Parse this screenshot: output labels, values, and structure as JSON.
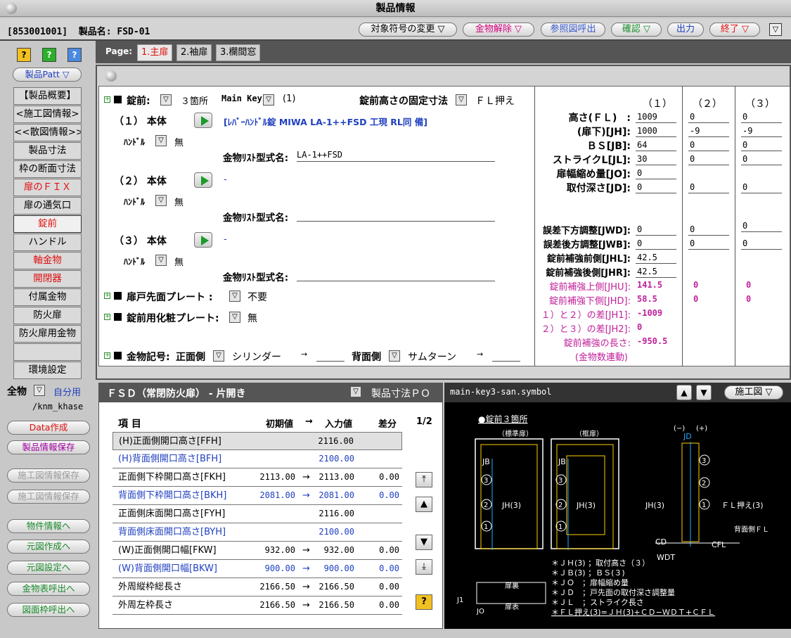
{
  "window": {
    "title": "製品情報"
  },
  "header": {
    "code": "[853001001]",
    "product_label": "製品名: FSD-01",
    "buttons": [
      {
        "label": "対象符号の変更 ▽",
        "color": "#000"
      },
      {
        "label": "金物解除 ▽",
        "color": "#d0007a"
      },
      {
        "label": "参照図呼出",
        "color": "#3a58c8"
      },
      {
        "label": "確認 ▽",
        "color": "#1a8a2a"
      },
      {
        "label": "出力",
        "color": "#2040c0"
      },
      {
        "label": "終了 ▽",
        "color": "#e01010"
      }
    ],
    "corner": "▽"
  },
  "sidebar": {
    "help": [
      "?",
      "?",
      "?"
    ],
    "pattern": "製品Patt ▽",
    "items": [
      {
        "label": "【製品概要】",
        "color": "#000"
      },
      {
        "label": "<施工図情報>",
        "color": "#000"
      },
      {
        "label": "<<散図情報>>",
        "color": "#000"
      },
      {
        "label": "製品寸法",
        "color": "#000"
      },
      {
        "label": "枠の断面寸法",
        "color": "#000"
      },
      {
        "label": "扉のＦＩＸ",
        "color": "#e01010"
      },
      {
        "label": "扉の通気口",
        "color": "#000"
      },
      {
        "label": "錠前",
        "color": "#e01010"
      },
      {
        "label": "ハンドル",
        "color": "#000"
      },
      {
        "label": "軸金物",
        "color": "#e01010"
      },
      {
        "label": "開閉器",
        "color": "#e01010"
      },
      {
        "label": "付属金物",
        "color": "#000"
      },
      {
        "label": "防火扉",
        "color": "#000"
      },
      {
        "label": "防火扉用金物",
        "color": "#000"
      },
      {
        "label": "",
        "color": "#000"
      },
      {
        "label": "環境設定",
        "color": "#000"
      }
    ],
    "kanamono_label": "全物",
    "kanamono_mode": "自分用",
    "path": "/knm_khase",
    "actions": [
      {
        "label": "Data作成",
        "color": "#e01010"
      },
      {
        "label": "製品情報保存",
        "color": "#a000a0"
      },
      {
        "label": "施工図情報保存",
        "color": "#9a9a9a"
      },
      {
        "label": "施工図情報保存",
        "color": "#9a9a9a"
      },
      {
        "label": "物件情報へ",
        "color": "#1a8a2a"
      },
      {
        "label": "元図作成へ",
        "color": "#1a8a2a"
      },
      {
        "label": "元図設定へ",
        "color": "#1a8a2a"
      },
      {
        "label": "金物表呼出へ",
        "color": "#1a8a2a"
      },
      {
        "label": "図面枠呼出へ",
        "color": "#1a8a2a"
      }
    ]
  },
  "pages": {
    "label": "Page:",
    "tabs": [
      "1.主扉",
      "2.袖扉",
      "3.欄間窓"
    ]
  },
  "lock": {
    "title": "錠前:",
    "count": "３箇所",
    "mainkey_label": "Main Key:",
    "mainkey_value": "(1)",
    "fixed_label": "錠前高さの固定寸法",
    "fixed_value": "ＦＬ押え",
    "bodies": [
      {
        "label": "（１） 本体",
        "desc": "[ﾚﾊﾞｰﾊﾝﾄﾞﾙ錠 MIWA LA-1++FSD 工現 RL同 備]",
        "handle_label": "ﾊﾝﾄﾞﾙ",
        "handle_value": "無",
        "list_label": "金物ﾘｽﾄ型式名:",
        "list_value": "LA-1++FSD"
      },
      {
        "label": "（２） 本体",
        "desc": "-",
        "handle_label": "ﾊﾝﾄﾞﾙ",
        "handle_value": "無",
        "list_label": "金物ﾘｽﾄ型式名:",
        "list_value": ""
      },
      {
        "label": "（３） 本体",
        "desc": "-",
        "handle_label": "ﾊﾝﾄﾞﾙ",
        "handle_value": "無",
        "list_label": "金物ﾘｽﾄ型式名:",
        "list_value": ""
      }
    ],
    "plate1_label": "扉戸先面プレート :",
    "plate1_value": "不要",
    "plate2_label": "錠前用化粧プレート:",
    "plate2_value": "無",
    "sym_label": "金物記号:",
    "front_label": "正面側",
    "front_value": "シリンダー",
    "back_label": "背面側",
    "back_value": "サムターン",
    "arrow": "→"
  },
  "dims": {
    "cols": [
      "（１）",
      "（２）",
      "（３）"
    ],
    "rows": [
      {
        "label": "高さ(ＦＬ)　:",
        "v": [
          "1009",
          "0",
          "0"
        ]
      },
      {
        "label": "(扉下)[JH]:",
        "v": [
          "1000",
          "-9",
          "-9"
        ]
      },
      {
        "label": "ＢＳ[JB]:",
        "v": [
          "64",
          "0",
          "0"
        ]
      },
      {
        "label": "ストライクL[JL]:",
        "v": [
          "30",
          "0",
          "0"
        ]
      },
      {
        "label": "扉幅縮め量[JO]:",
        "v": [
          "0",
          "",
          ""
        ]
      },
      {
        "label": "取付深さ[JD]:",
        "v": [
          "0",
          "0",
          "0"
        ]
      }
    ],
    "rows2": [
      {
        "label": "誤差下方調整[JWD]:",
        "v": [
          "0",
          "0",
          "0"
        ]
      },
      {
        "label": "誤差後方調整[JWB]:",
        "v": [
          "0",
          "0",
          "0"
        ]
      },
      {
        "label": "錠前補強前側[JHL]:",
        "v": [
          "42.5",
          "",
          ""
        ]
      },
      {
        "label": "錠前補強後側[JHR]:",
        "v": [
          "42.5",
          "",
          ""
        ]
      }
    ],
    "calc": [
      {
        "label": "錠前補強上側[JHU]:",
        "v": [
          "141.5",
          "0",
          "0"
        ]
      },
      {
        "label": "錠前補強下側[JHD]:",
        "v": [
          "58.5",
          "0",
          "0"
        ]
      },
      {
        "label": "１）と２）の差[JH1]:",
        "v": [
          "-1009",
          "",
          ""
        ]
      },
      {
        "label": "２）と３）の差[JH2]:",
        "v": [
          "0",
          "",
          ""
        ]
      },
      {
        "label": "錠前補強の長さ:",
        "v": [
          "-950.5",
          "",
          ""
        ]
      },
      {
        "label": "(金物数連動)",
        "v": [
          "",
          "",
          ""
        ]
      }
    ]
  },
  "table": {
    "title": "ＦＳＤ（常閉防火扉） - 片開き",
    "mode": "製品寸法ＰＯ",
    "headers": {
      "item": "項 目",
      "init": "初期値",
      "arrow": "→",
      "input": "入力値",
      "diff": "差分",
      "page": "1/2"
    },
    "rows": [
      {
        "name": "(H)正面側開口高さ[FFH]",
        "init": "",
        "arrow": "",
        "input": "2116.00",
        "diff": "",
        "blue": false
      },
      {
        "name": "(H)背面側開口高さ[BFH]",
        "init": "",
        "arrow": "",
        "input": "2100.00",
        "diff": "",
        "blue": true
      },
      {
        "name": "正面側下枠開口高さ[FKH]",
        "init": "2113.00",
        "arrow": "→",
        "input": "2113.00",
        "diff": "0.00",
        "blue": false
      },
      {
        "name": "背面側下枠開口高さ[BKH]",
        "init": "2081.00",
        "arrow": "→",
        "input": "2081.00",
        "diff": "0.00",
        "blue": true
      },
      {
        "name": "正面側床面開口高さ[FYH]",
        "init": "",
        "arrow": "",
        "input": "2116.00",
        "diff": "",
        "blue": false
      },
      {
        "name": "背面側床面開口高さ[BYH]",
        "init": "",
        "arrow": "",
        "input": "2100.00",
        "diff": "",
        "blue": true
      },
      {
        "name": "(W)正面側開口幅[FKW]",
        "init": "932.00",
        "arrow": "→",
        "input": "932.00",
        "diff": "0.00",
        "blue": false
      },
      {
        "name": "(W)背面側開口幅[BKW]",
        "init": "900.00",
        "arrow": "→",
        "input": "900.00",
        "diff": "0.00",
        "blue": true
      },
      {
        "name": "外周縦枠総長さ",
        "init": "2166.50",
        "arrow": "→",
        "input": "2166.50",
        "diff": "0.00",
        "blue": false
      },
      {
        "name": "外周左枠長さ",
        "init": "2166.50",
        "arrow": "→",
        "input": "2166.50",
        "diff": "0.00",
        "blue": false
      }
    ]
  },
  "symbol": {
    "file": "main-key3-san.symbol",
    "mode": "施工図 ▽",
    "heading": "●錠前３箇所",
    "std_label": "（標準扉）",
    "frame_label": "（框扉）",
    "jb": "JB",
    "jh3": "JH(3)",
    "jd": "JD",
    "minus": "(−)",
    "plus": "(+)",
    "fl": "ＦＬ押え(3)",
    "back_fl": "背面側ＦＬ",
    "cd": "CD",
    "cfl": "CFL",
    "wdt": "WDT",
    "j1": "J1",
    "jo": "JO",
    "door_top": "扉裏",
    "door_bottom": "扉表",
    "n1": "1",
    "n2": "2",
    "n3": "3",
    "notes": [
      "＊ＪＨ(3) ；取付高さ（３）",
      "＊ＪＢ(3) ；ＢＳ(３)",
      "＊ＪＯ　；扉幅縮め量",
      "＊ＪＤ　；戸先面の取付深さ調整量",
      "＊ＪＬ　；ストライク長さ"
    ],
    "formula": "＊ＦＬ押え(3)=ＪＨ(3)+ＣＤ−ＷＤＴ+ＣＦＬ"
  }
}
